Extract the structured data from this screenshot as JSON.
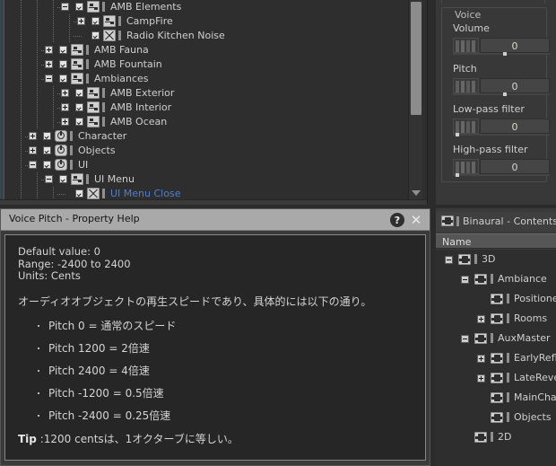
{
  "project_tree": {
    "scrollbar": {
      "name": "vertical-scrollbar"
    },
    "rows": [
      {
        "label": "AMB Elements",
        "depth": 3,
        "toggle": "minus",
        "icon": "actor-mixer-icon",
        "checked": true,
        "selected": false
      },
      {
        "label": "CampFire",
        "depth": 4,
        "toggle": "plus",
        "icon": "actor-mixer-icon",
        "checked": true,
        "selected": false
      },
      {
        "label": "Radio Kitchen Noise",
        "depth": 4,
        "toggle": "none",
        "icon": "sound-sfx-icon",
        "checked": true,
        "selected": false
      },
      {
        "label": "AMB Fauna",
        "depth": 2,
        "toggle": "plus",
        "icon": "actor-mixer-icon",
        "checked": true,
        "selected": false
      },
      {
        "label": "AMB Fountain",
        "depth": 2,
        "toggle": "plus",
        "icon": "actor-mixer-icon",
        "checked": true,
        "selected": false
      },
      {
        "label": "Ambiances",
        "depth": 2,
        "toggle": "minus",
        "icon": "actor-mixer-icon",
        "checked": true,
        "selected": false
      },
      {
        "label": "AMB Exterior",
        "depth": 3,
        "toggle": "plus",
        "icon": "actor-mixer-icon",
        "checked": true,
        "selected": false
      },
      {
        "label": "AMB Interior",
        "depth": 3,
        "toggle": "plus",
        "icon": "actor-mixer-icon",
        "checked": true,
        "selected": false
      },
      {
        "label": "AMB Ocean",
        "depth": 3,
        "toggle": "plus",
        "icon": "actor-mixer-icon",
        "checked": true,
        "selected": false
      },
      {
        "label": "Character",
        "depth": 1,
        "toggle": "plus",
        "icon": "switch-container-icon",
        "checked": true,
        "selected": false
      },
      {
        "label": "Objects",
        "depth": 1,
        "toggle": "plus",
        "icon": "switch-container-icon",
        "checked": true,
        "selected": false
      },
      {
        "label": "UI",
        "depth": 1,
        "toggle": "minus",
        "icon": "switch-container-icon",
        "checked": true,
        "selected": false
      },
      {
        "label": "UI Menu",
        "depth": 2,
        "toggle": "minus",
        "icon": "actor-mixer-icon",
        "checked": true,
        "selected": false
      },
      {
        "label": "UI Menu Close",
        "depth": 3,
        "toggle": "none",
        "icon": "sound-sfx-icon",
        "checked": true,
        "selected": true
      }
    ]
  },
  "voice_panel": {
    "group_label": "Voice",
    "fields": [
      {
        "label": "Volume",
        "value": "0",
        "handle_pct": 52
      },
      {
        "label": "Pitch",
        "value": "0",
        "handle_pct": 52
      },
      {
        "label": "Low-pass filter",
        "value": "0",
        "handle_pct": 3
      },
      {
        "label": "High-pass filter",
        "value": "0",
        "handle_pct": 3
      }
    ]
  },
  "help_window": {
    "title": "Voice Pitch - Property Help",
    "help_button": "?",
    "close_button": "✕",
    "meta": "Default value: 0\nRange: -2400 to 2400\nUnits: Cents",
    "paragraph": "オーディオオブジェクトの再生スピードであり、具体的には以下の通り。",
    "bullets": [
      "Pitch 0 = 通常のスピード",
      "Pitch 1200 = 2倍速",
      "Pitch 2400 = 4倍速",
      "Pitch -1200 = 0.5倍速",
      "Pitch -2400 = 0.25倍速"
    ],
    "tip_label": "Tip",
    "tip_text": " :1200 centsは、1オクターブに等しい。"
  },
  "binaural_panel": {
    "tab_title": "Binaural - Contents E",
    "column_header": "Name",
    "rows": [
      {
        "label": "3D",
        "depth": 0,
        "toggle": "minus",
        "icon": "bus-icon"
      },
      {
        "label": "Ambiance",
        "depth": 1,
        "toggle": "minus",
        "icon": "bus-icon"
      },
      {
        "label": "Positioned",
        "depth": 2,
        "toggle": "none",
        "icon": "bus-icon"
      },
      {
        "label": "Rooms",
        "depth": 2,
        "toggle": "plus",
        "icon": "bus-icon"
      },
      {
        "label": "AuxMaster",
        "depth": 1,
        "toggle": "minus",
        "icon": "bus-icon"
      },
      {
        "label": "EarlyReflec",
        "depth": 2,
        "toggle": "plus",
        "icon": "bus-icon"
      },
      {
        "label": "LateRever",
        "depth": 2,
        "toggle": "plus",
        "icon": "bus-icon"
      },
      {
        "label": "MainCharacte",
        "depth": 2,
        "toggle": "none",
        "icon": "bus-icon"
      },
      {
        "label": "Objects",
        "depth": 2,
        "toggle": "none",
        "icon": "bus-icon"
      },
      {
        "label": "2D",
        "depth": 1,
        "toggle": "none",
        "icon": "bus-icon"
      }
    ]
  },
  "colors": {
    "panel_bg": "#2e2e2e",
    "chrome_bg": "#3a3a3a",
    "selection_blue": "#4f7fd4",
    "title_bar": "#a9a9a9",
    "help_body_bg": "#262626"
  }
}
